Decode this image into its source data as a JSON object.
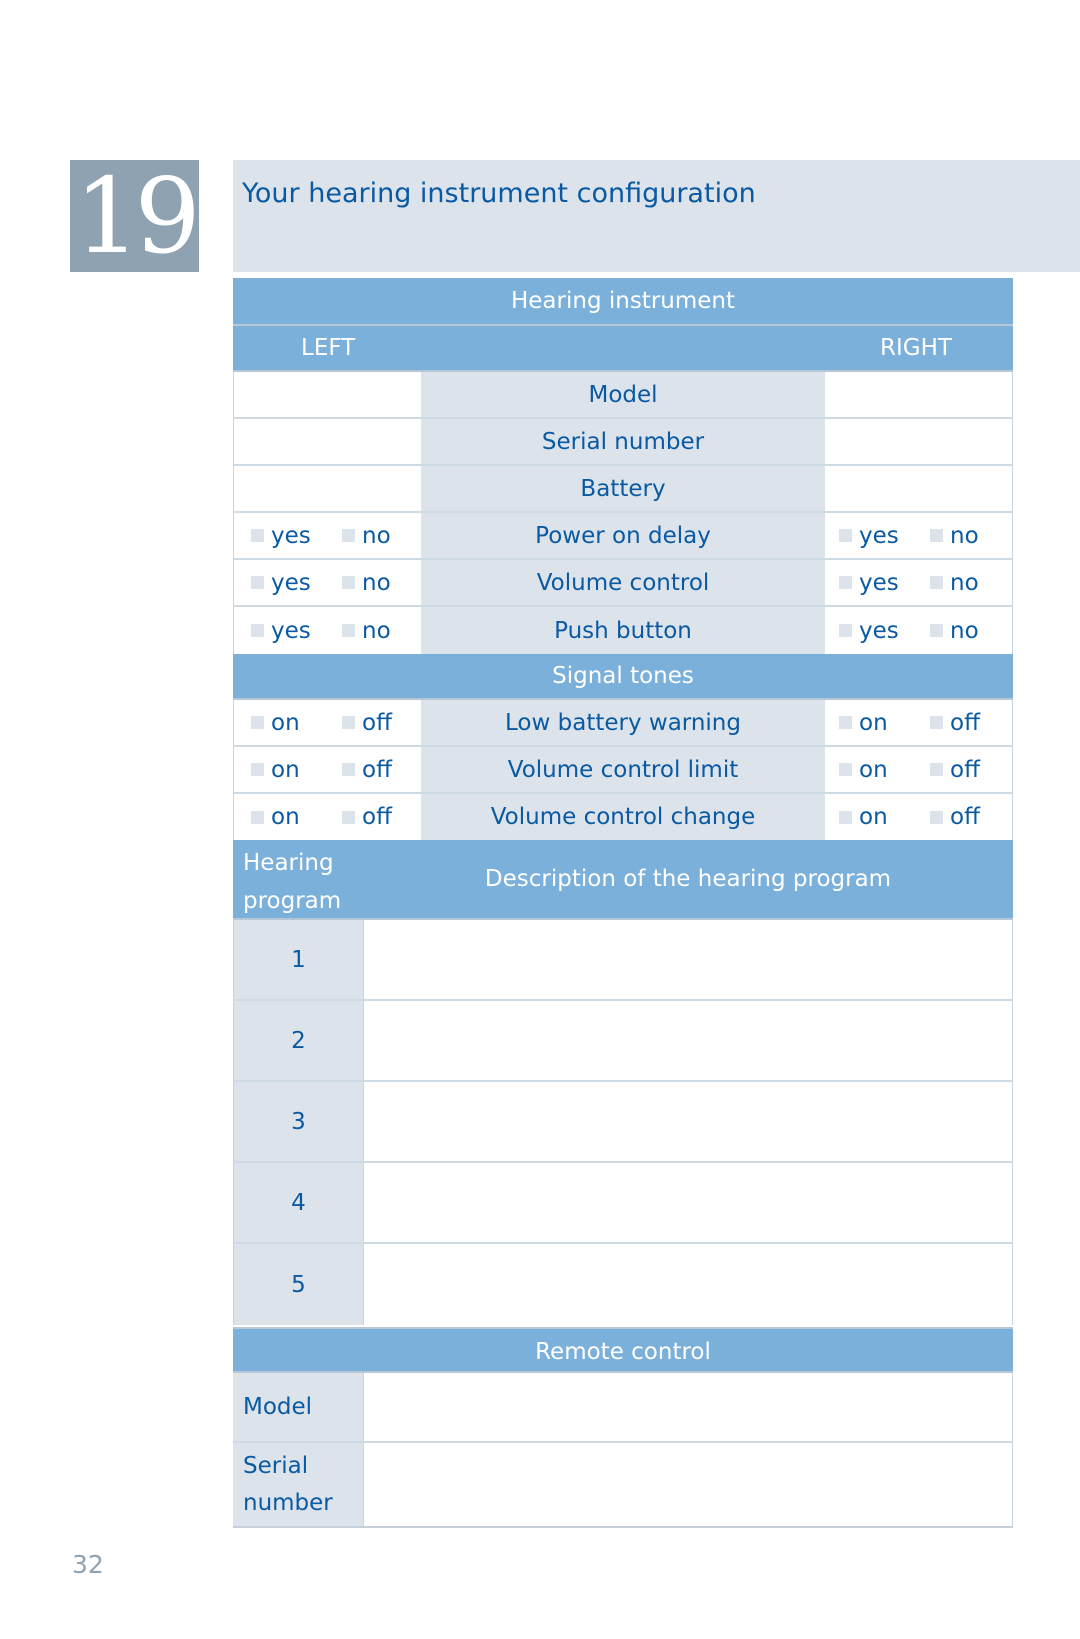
{
  "chapter": {
    "number": "19",
    "title": "Your hearing instrument configuration"
  },
  "hearing_instrument": {
    "header": "Hearing instrument",
    "left_label": "LEFT",
    "right_label": "RIGHT",
    "info_rows": [
      {
        "label": "Model",
        "left": "",
        "right": ""
      },
      {
        "label": "Serial number",
        "left": "",
        "right": ""
      },
      {
        "label": "Battery",
        "left": "",
        "right": ""
      }
    ],
    "option_rows": [
      {
        "label": "Power on delay",
        "opt1": "yes",
        "opt2": "no"
      },
      {
        "label": "Volume control",
        "opt1": "yes",
        "opt2": "no"
      },
      {
        "label": "Push button",
        "opt1": "yes",
        "opt2": "no"
      }
    ]
  },
  "signal_tones": {
    "header": "Signal tones",
    "rows": [
      {
        "label": "Low battery warning",
        "opt1": "on",
        "opt2": "off"
      },
      {
        "label": "Volume control limit",
        "opt1": "on",
        "opt2": "off"
      },
      {
        "label": "Volume control change",
        "opt1": "on",
        "opt2": "off"
      }
    ]
  },
  "programs": {
    "header_left_line1": "Hearing",
    "header_left_line2": "program",
    "header_right": "Description of the hearing program",
    "rows": [
      {
        "number": "1",
        "description": ""
      },
      {
        "number": "2",
        "description": ""
      },
      {
        "number": "3",
        "description": ""
      },
      {
        "number": "4",
        "description": ""
      },
      {
        "number": "5",
        "description": ""
      }
    ]
  },
  "remote_control": {
    "header": "Remote control",
    "model_label": "Model",
    "serial_label_line1": "Serial",
    "serial_label_line2": "number",
    "model_value": "",
    "serial_value": ""
  },
  "page_number": "32"
}
